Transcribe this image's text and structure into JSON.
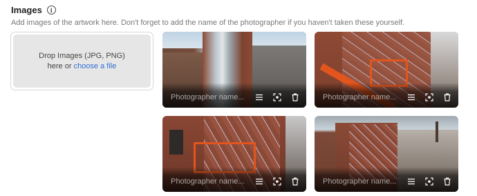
{
  "section": {
    "title": "Images",
    "info_icon": "info-icon",
    "helper": "Add images of the artwork here. Don't forget to add the name of the photographer if you haven't taken these yourself."
  },
  "dropzone": {
    "line1": "Drop Images (JPG, PNG)",
    "line2_prefix": "here or ",
    "link": "choose a file"
  },
  "images": [
    {
      "photographer_placeholder": "Photographer name...",
      "photographer_value": ""
    },
    {
      "photographer_placeholder": "Photographer name...",
      "photographer_value": ""
    },
    {
      "photographer_placeholder": "Photographer name...",
      "photographer_value": ""
    },
    {
      "photographer_placeholder": "Photographer name...",
      "photographer_value": ""
    }
  ],
  "actions": [
    "menu-icon",
    "crop-focus-icon",
    "trash-icon"
  ],
  "colors": {
    "link": "#2f6fd6",
    "dropzone_bg": "#e6e6e6",
    "lift_orange": "#e2561e"
  }
}
